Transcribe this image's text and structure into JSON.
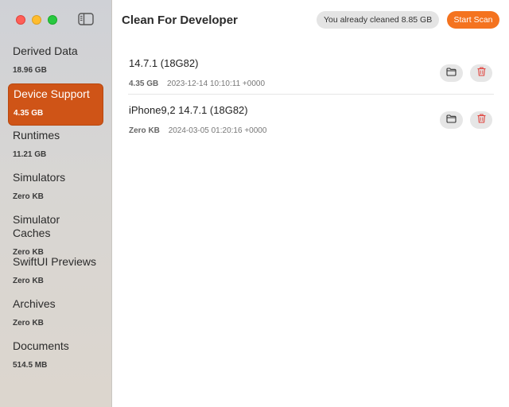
{
  "app": {
    "title": "Clean For Developer"
  },
  "header": {
    "cleaned_text": "You already cleaned 8.85 GB",
    "scan_label": "Start Scan",
    "accent_color": "#f4731f"
  },
  "sidebar": {
    "toggle_icon": "sidebar-toggle-icon",
    "items": [
      {
        "label": "Derived Data",
        "size": "18.96 GB"
      },
      {
        "label": "Device Support",
        "size": "4.35 GB",
        "selected": true
      },
      {
        "label": "Runtimes",
        "size": "11.21 GB"
      },
      {
        "label": "Simulators",
        "size": "Zero KB"
      },
      {
        "label": "Simulator Caches",
        "size": "Zero KB"
      },
      {
        "label": "SwiftUI Previews",
        "size": "Zero KB"
      },
      {
        "label": "Archives",
        "size": "Zero KB"
      },
      {
        "label": "Documents",
        "size": "514.5 MB"
      }
    ],
    "selected_color": "#cf5417"
  },
  "main": {
    "rows": [
      {
        "name": "14.7.1 (18G82)",
        "size": "4.35 GB",
        "date": "2023-12-14 10:10:11 +0000",
        "folder_icon": "folder-icon",
        "delete_icon": "trash-icon"
      },
      {
        "name": "iPhone9,2 14.7.1 (18G82)",
        "size": "Zero KB",
        "date": "2024-03-05 01:20:16 +0000",
        "folder_icon": "folder-icon",
        "delete_icon": "trash-icon"
      }
    ]
  }
}
